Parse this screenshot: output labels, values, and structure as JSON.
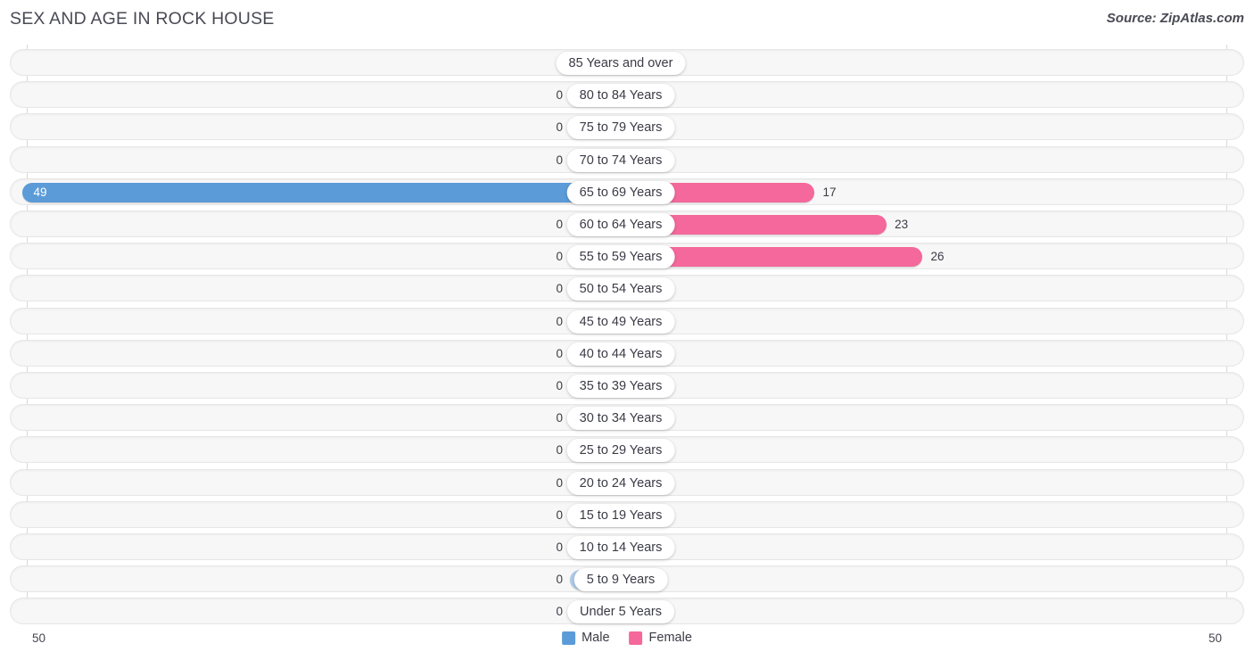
{
  "header": {
    "title": "SEX AND AGE IN ROCK HOUSE",
    "source": "Source: ZipAtlas.com"
  },
  "legend": {
    "male_label": "Male",
    "female_label": "Female",
    "male_color": "#5b9bd8",
    "female_color": "#f4689b"
  },
  "axis": {
    "left_max": "50",
    "right_max": "50"
  },
  "chart_data": {
    "type": "bar",
    "title": "SEX AND AGE IN ROCK HOUSE",
    "subtitle": "",
    "xlabel": "",
    "ylabel": "",
    "orientation": "horizontal",
    "style": "population-pyramid",
    "grid": false,
    "legend_position": "bottom-center",
    "xlim": [
      0,
      50
    ],
    "axis_max": 50,
    "categories": [
      "85 Years and over",
      "80 to 84 Years",
      "75 to 79 Years",
      "70 to 74 Years",
      "65 to 69 Years",
      "60 to 64 Years",
      "55 to 59 Years",
      "50 to 54 Years",
      "45 to 49 Years",
      "40 to 44 Years",
      "35 to 39 Years",
      "30 to 34 Years",
      "25 to 29 Years",
      "20 to 24 Years",
      "15 to 19 Years",
      "10 to 14 Years",
      "5 to 9 Years",
      "Under 5 Years"
    ],
    "series": [
      {
        "name": "Male",
        "color": "#5b9bd8",
        "side": "left",
        "values": [
          0,
          0,
          0,
          0,
          49,
          0,
          0,
          0,
          0,
          0,
          0,
          0,
          0,
          0,
          0,
          0,
          0,
          0
        ]
      },
      {
        "name": "Female",
        "color": "#f4689b",
        "side": "right",
        "values": [
          0,
          0,
          0,
          0,
          17,
          23,
          26,
          0,
          0,
          0,
          0,
          0,
          0,
          0,
          0,
          0,
          0,
          0
        ]
      }
    ]
  },
  "rows": [
    {
      "age": "85 Years and over",
      "male": "0",
      "female": "0"
    },
    {
      "age": "80 to 84 Years",
      "male": "0",
      "female": "0"
    },
    {
      "age": "75 to 79 Years",
      "male": "0",
      "female": "0"
    },
    {
      "age": "70 to 74 Years",
      "male": "0",
      "female": "0"
    },
    {
      "age": "65 to 69 Years",
      "male": "49",
      "female": "17"
    },
    {
      "age": "60 to 64 Years",
      "male": "0",
      "female": "23"
    },
    {
      "age": "55 to 59 Years",
      "male": "0",
      "female": "26"
    },
    {
      "age": "50 to 54 Years",
      "male": "0",
      "female": "0"
    },
    {
      "age": "45 to 49 Years",
      "male": "0",
      "female": "0"
    },
    {
      "age": "40 to 44 Years",
      "male": "0",
      "female": "0"
    },
    {
      "age": "35 to 39 Years",
      "male": "0",
      "female": "0"
    },
    {
      "age": "30 to 34 Years",
      "male": "0",
      "female": "0"
    },
    {
      "age": "25 to 29 Years",
      "male": "0",
      "female": "0"
    },
    {
      "age": "20 to 24 Years",
      "male": "0",
      "female": "0"
    },
    {
      "age": "15 to 19 Years",
      "male": "0",
      "female": "0"
    },
    {
      "age": "10 to 14 Years",
      "male": "0",
      "female": "0"
    },
    {
      "age": "5 to 9 Years",
      "male": "0",
      "female": "0"
    },
    {
      "age": "Under 5 Years",
      "male": "0",
      "female": "0"
    }
  ]
}
